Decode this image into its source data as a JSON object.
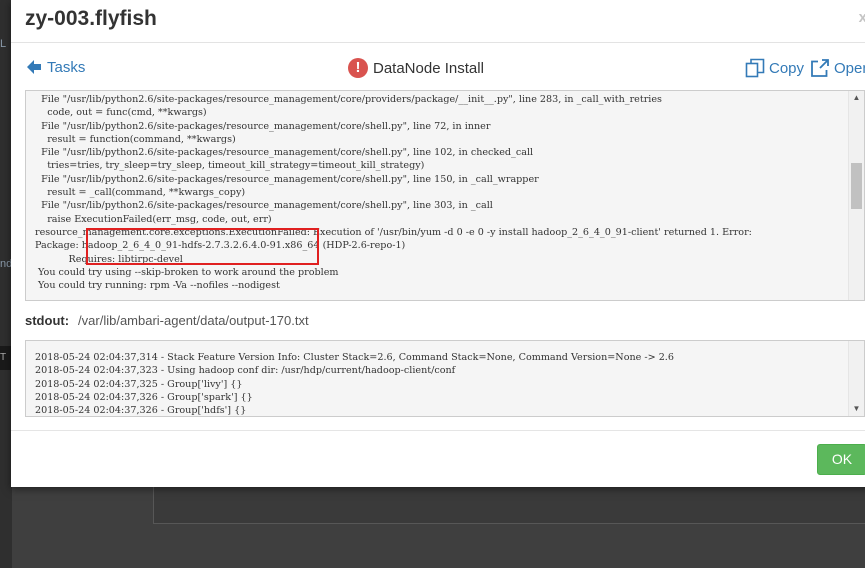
{
  "modal": {
    "title": "zy-003.flyfish",
    "close_glyph": "x"
  },
  "toolbar": {
    "back_label": "Tasks",
    "task_title": "DataNode Install",
    "status_icon": "error-icon",
    "status_glyph": "!",
    "copy_label": "Copy",
    "open_label": "Open"
  },
  "stderr": {
    "lines": [
      "  File \"/usr/lib/python2.6/site-packages/resource_management/core/providers/package/__init__.py\", line 283, in _call_with_retries",
      "    code, out = func(cmd, **kwargs)",
      "  File \"/usr/lib/python2.6/site-packages/resource_management/core/shell.py\", line 72, in inner",
      "    result = function(command, **kwargs)",
      "  File \"/usr/lib/python2.6/site-packages/resource_management/core/shell.py\", line 102, in checked_call",
      "    tries=tries, try_sleep=try_sleep, timeout_kill_strategy=timeout_kill_strategy)",
      "  File \"/usr/lib/python2.6/site-packages/resource_management/core/shell.py\", line 150, in _call_wrapper",
      "    result = _call(command, **kwargs_copy)",
      "  File \"/usr/lib/python2.6/site-packages/resource_management/core/shell.py\", line 303, in _call",
      "    raise ExecutionFailed(err_msg, code, out, err)",
      "resource_management.core.exceptions.ExecutionFailed: Execution of '/usr/bin/yum -d 0 -e 0 -y install hadoop_2_6_4_0_91-client' returned 1. Error:",
      "Package: hadoop_2_6_4_0_91-hdfs-2.7.3.2.6.4.0-91.x86_64 (HDP-2.6-repo-1)",
      "           Requires: libtirpc-devel",
      " You could try using --skip-broken to work around the problem",
      " You could try running: rpm -Va --nofiles --nodigest"
    ]
  },
  "stdout": {
    "label": "stdout:",
    "path": "/var/lib/ambari-agent/data/output-170.txt",
    "lines": [
      "2018-05-24 02:04:37,314 - Stack Feature Version Info: Cluster Stack=2.6, Command Stack=None, Command Version=None -> 2.6",
      "2018-05-24 02:04:37,323 - Using hadoop conf dir: /usr/hdp/current/hadoop-client/conf",
      "2018-05-24 02:04:37,325 - Group['livy'] {}",
      "2018-05-24 02:04:37,326 - Group['spark'] {}",
      "2018-05-24 02:04:37,326 - Group['hdfs'] {}"
    ]
  },
  "footer": {
    "ok_label": "OK"
  },
  "background": {
    "frag_1": "L",
    "frag_2": "nd",
    "frag_3": "T"
  },
  "colors": {
    "link": "#337ab7",
    "error": "#d9534f",
    "ok_button": "#5cb85c",
    "highlight_box": "#e02020"
  }
}
